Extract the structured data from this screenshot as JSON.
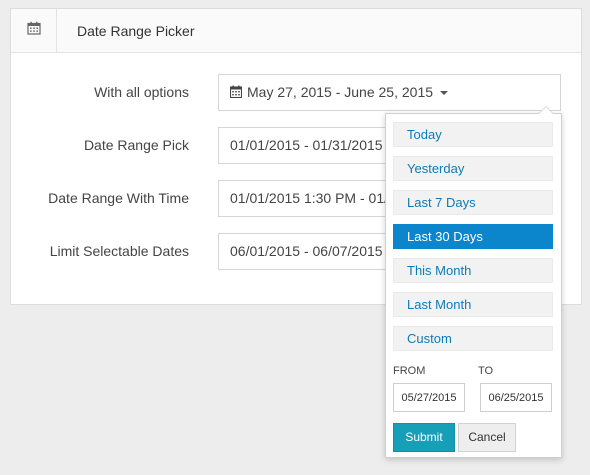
{
  "panel": {
    "title": "Date Range Picker",
    "header_icon": "calendar-icon"
  },
  "rows": [
    {
      "label": "With all options",
      "value": "May 27, 2015 - June 25, 2015"
    },
    {
      "label": "Date Range Pick",
      "value": "01/01/2015 - 01/31/2015"
    },
    {
      "label": "Date Range With Time",
      "value": "01/01/2015 1:30 PM - 01/01/2015 2:00 PM"
    },
    {
      "label": "Limit Selectable Dates",
      "value": "06/01/2015 - 06/07/2015"
    }
  ],
  "dropdown": {
    "ranges": [
      "Today",
      "Yesterday",
      "Last 7 Days",
      "Last 30 Days",
      "This Month",
      "Last Month",
      "Custom"
    ],
    "active_range": "Last 30 Days",
    "from_label": "FROM",
    "to_label": "TO",
    "from_value": "05/27/2015",
    "to_value": "06/25/2015",
    "submit_label": "Submit",
    "cancel_label": "Cancel"
  },
  "colors": {
    "accent": "#0b85cc",
    "link": "#0e7bb7",
    "submit": "#169fb6"
  }
}
